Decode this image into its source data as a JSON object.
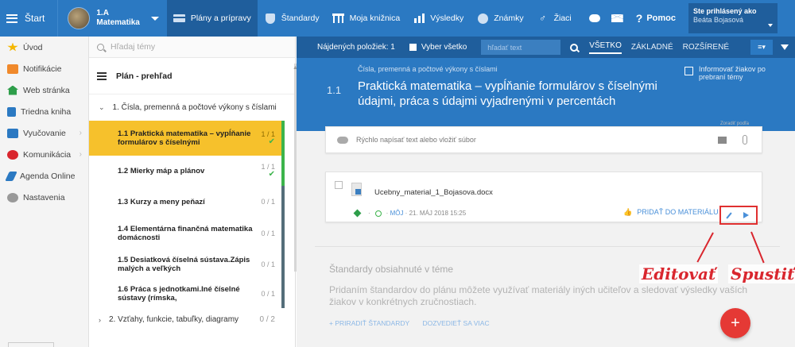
{
  "topbar": {
    "start_label": "Štart",
    "class_name": "1.A",
    "class_subject": "Matematika",
    "nav_items": [
      "Plány a prípravy",
      "Štandardy",
      "Moja knižnica",
      "Výsledky",
      "Známky",
      "Žiaci"
    ],
    "help_label": "Pomoc",
    "user_line1": "Ste prihlásený ako",
    "user_line2": "Beáta Bojasová"
  },
  "leftnav": {
    "items": [
      "Úvod",
      "Notifikácie",
      "Web stránka",
      "Triedna kniha",
      "Vyučovanie",
      "Komunikácia",
      "Agenda Online",
      "Nastavenia"
    ]
  },
  "topics": {
    "search_placeholder": "Hľadaj témy",
    "plan_header": "Plán - prehľad",
    "chapter1": {
      "label": "1. Čísla, premenná a počtové výkony s číslami"
    },
    "chapter2": {
      "label": "2. Vzťahy, funkcie, tabuľky, diagramy",
      "count": "0 / 2"
    },
    "items": [
      {
        "title": "1.1 Praktická matematika – vypĺňanie formulárov s číselnými",
        "count": "1 / 1",
        "done": "✔"
      },
      {
        "title": "1.2 Mierky máp a plánov",
        "count": "1 / 1",
        "done": "✔"
      },
      {
        "title": "1.3 Kurzy a meny peňazí",
        "count": "0 / 1"
      },
      {
        "title": "1.4 Elementárna finančná matematika domácnosti",
        "count": "0 / 1"
      },
      {
        "title": "1.5 Desiatková číselná sústava.Zápis malých a veľkých",
        "count": "0 / 1"
      },
      {
        "title": "1.6 Práca s jednotkami.Iné číselné sústavy (rímska,",
        "count": "0 / 1"
      }
    ]
  },
  "main": {
    "found_label": "Nájdených položiek: 1",
    "select_all": "Vyber všetko",
    "search_placeholder": "hľadať text",
    "tabs": [
      "VŠETKO",
      "ZÁKLADNÉ",
      "ROZŠÍRENÉ"
    ],
    "hero_sub": "Čísla, premenná a počtové výkony s číslami",
    "hero_num": "1.1",
    "hero_title": "Praktická matematika – vypĺňanie formulárov s číselnými údajmi, práca s údajmi vyjadrenými v percentách",
    "inform_label": "Informovať žiakov po prebraní témy",
    "quick_write": "Rýchlo napísať text alebo vložiť súbor",
    "tiny_label": "Zoradiť podľa",
    "file_name": "Ucebny_material_1_Bojasova.docx",
    "meta_owner": "MÔJ",
    "meta_date": "21. MÁJ 2018 15:25",
    "add_to_materials": "PRIDAŤ DO MATERIÁLU",
    "standards_title": "Štandardy obsiahnuté v téme",
    "standards_desc": "Pridaním štandardov do plánu môžete využívať materiály iných učiteľov a sledovať výsledky vaších žiakov v konkrétnych zručnostiach.",
    "assign_standard": "+ PRIRADIŤ ŠTANDARDY",
    "learn_more": "DOZVEDIEŤ SA VIAC",
    "fab": "+"
  },
  "annotations": {
    "edit": "Editovať",
    "run": "Spustiť"
  },
  "colors": {
    "primary": "#2b79c2",
    "primary_dark": "#1f5e9c",
    "selected": "#f6c12c",
    "done": "#3cb44b",
    "fab": "#e53935",
    "annotation": "#d9262e"
  }
}
